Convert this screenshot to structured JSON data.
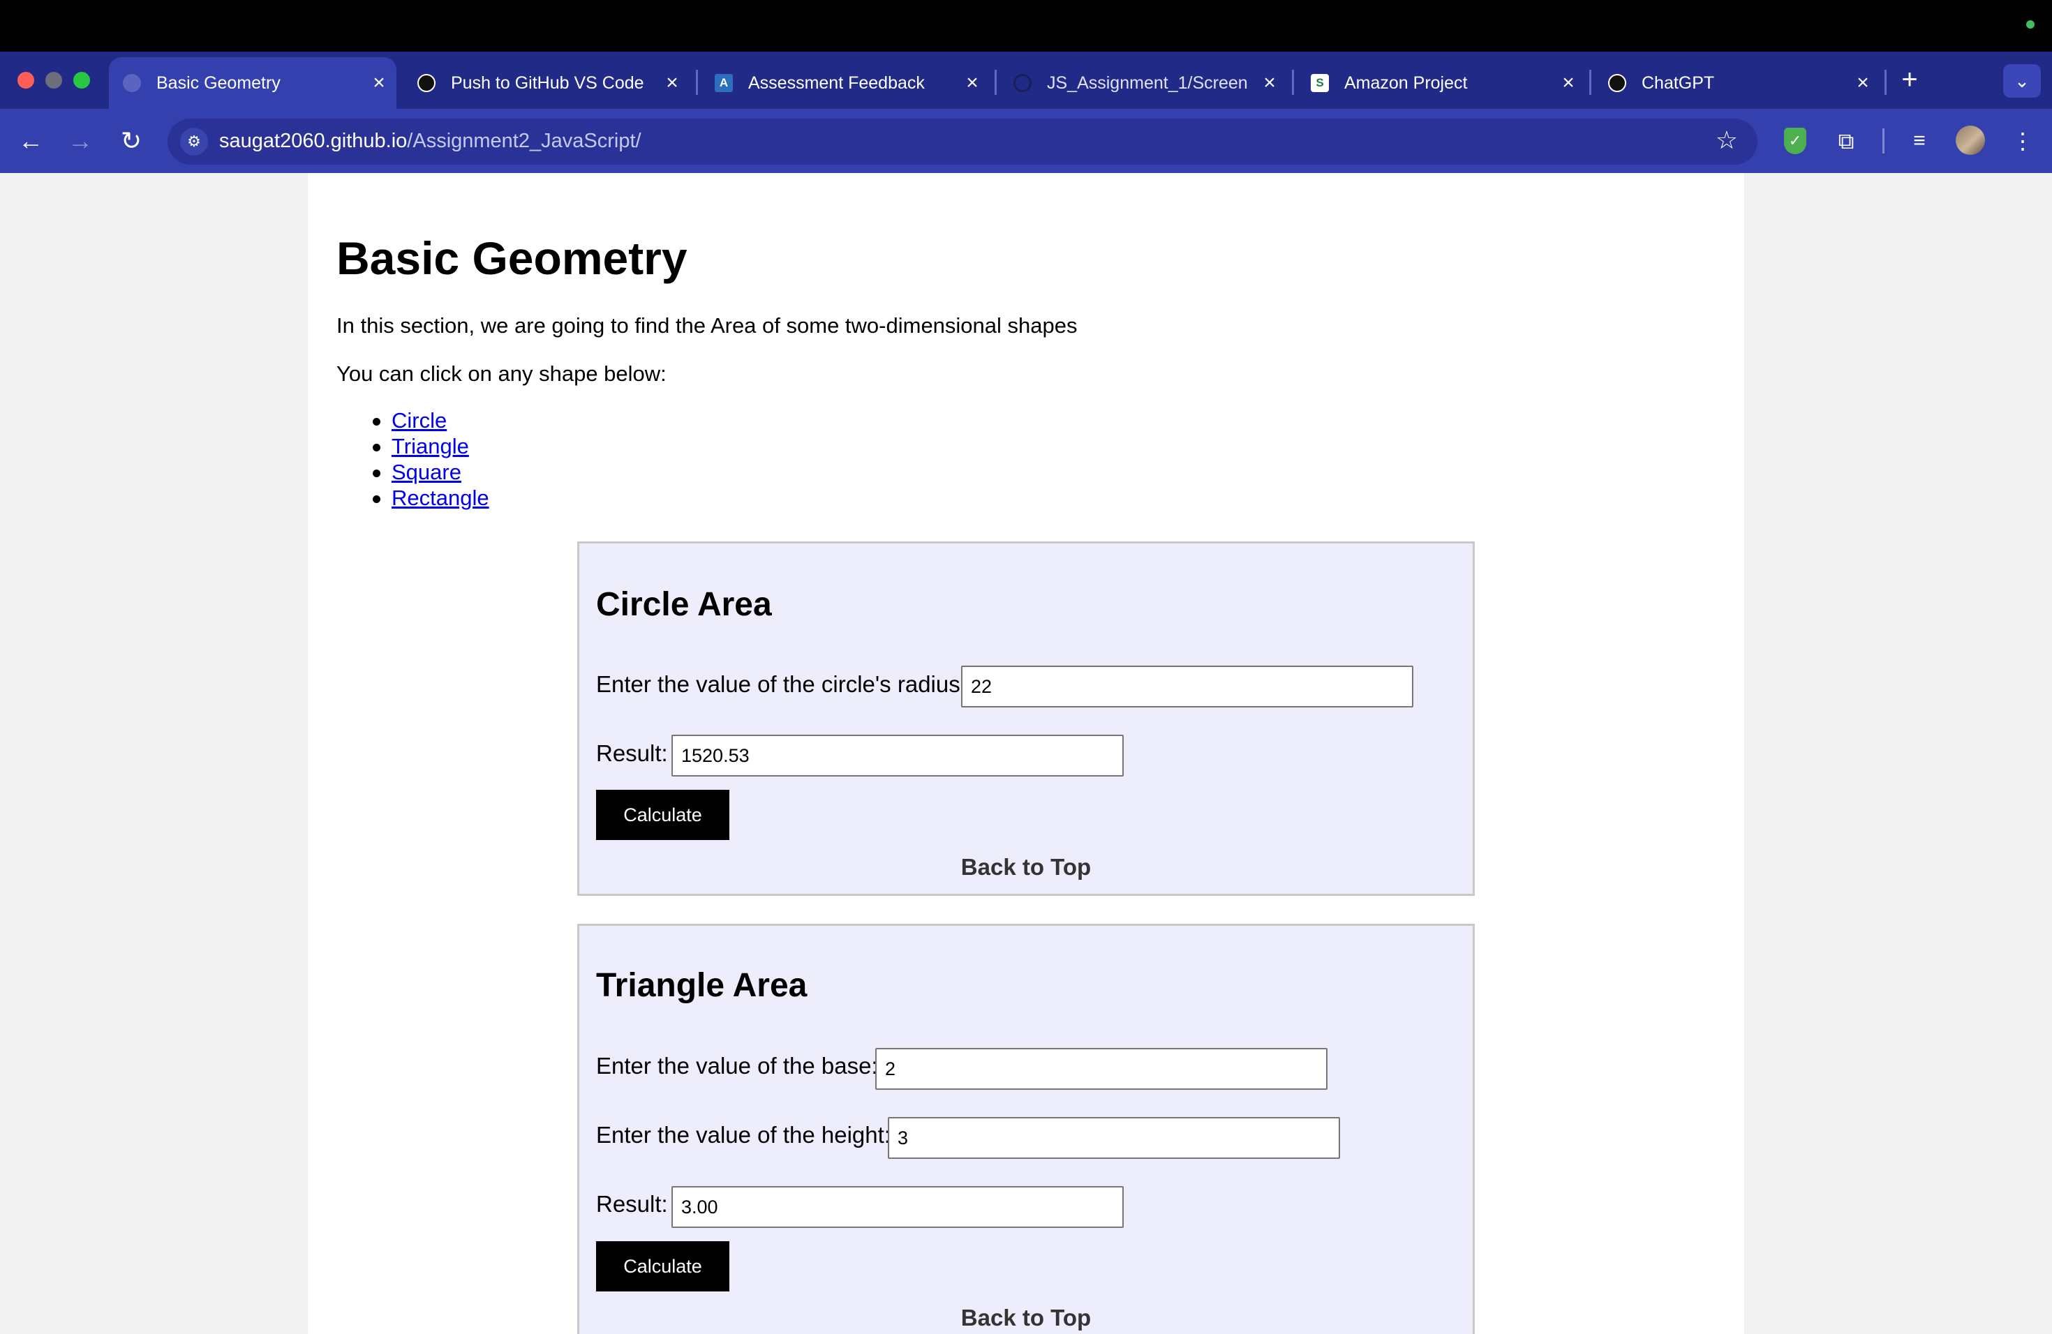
{
  "browser": {
    "tabs": [
      {
        "title": "Basic Geometry",
        "active": true,
        "icon": "globe-icon"
      },
      {
        "title": "Push to GitHub VS Code",
        "active": false,
        "icon": "openai-icon"
      },
      {
        "title": "Assessment Feedback",
        "active": false,
        "icon": "brightspace-icon"
      },
      {
        "title": "JS_Assignment_1/Screen",
        "active": false,
        "icon": "github-icon"
      },
      {
        "title": "Amazon Project",
        "active": false,
        "icon": "supersimple-icon"
      },
      {
        "title": "ChatGPT",
        "active": false,
        "icon": "openai-icon"
      }
    ],
    "url_host": "saugat2060.github.io",
    "url_path": "/Assignment2_JavaScript/"
  },
  "page": {
    "title": "Basic Geometry",
    "intro": "In this section, we are going to find the Area of some two-dimensional shapes",
    "prompt": "You can click on any shape below:",
    "shapes": [
      "Circle",
      "Triangle",
      "Square",
      "Rectangle"
    ]
  },
  "circle": {
    "heading": "Circle Area",
    "radius_label": "Enter the value of the circle's radius:",
    "radius_value": "22",
    "result_label": "Result:",
    "result_value": "1520.53",
    "button": "Calculate",
    "back_top": "Back to Top"
  },
  "triangle": {
    "heading": "Triangle Area",
    "base_label": "Enter the value of the base:",
    "base_value": "2",
    "height_label": "Enter the value of the height:",
    "height_value": "3",
    "result_label": "Result:",
    "result_value": "3.00",
    "button": "Calculate",
    "back_top": "Back to Top"
  },
  "colors": {
    "chrome": "#222a88",
    "toolbar": "#3440ad",
    "card_bg": "#ededfc",
    "link": "#0000ee"
  }
}
